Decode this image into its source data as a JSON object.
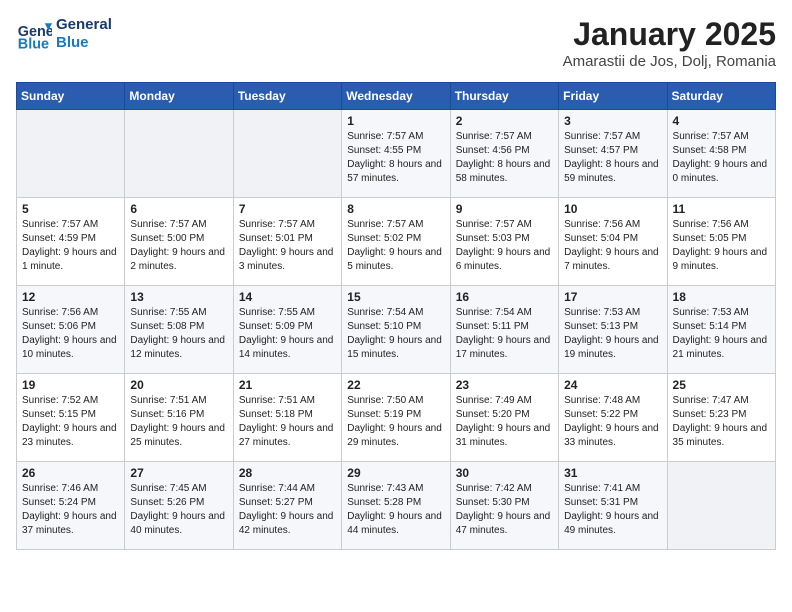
{
  "header": {
    "logo_line1": "General",
    "logo_line2": "Blue",
    "title": "January 2025",
    "subtitle": "Amarastii de Jos, Dolj, Romania"
  },
  "weekdays": [
    "Sunday",
    "Monday",
    "Tuesday",
    "Wednesday",
    "Thursday",
    "Friday",
    "Saturday"
  ],
  "weeks": [
    [
      {
        "day": "",
        "sunrise": "",
        "sunset": "",
        "daylight": ""
      },
      {
        "day": "",
        "sunrise": "",
        "sunset": "",
        "daylight": ""
      },
      {
        "day": "",
        "sunrise": "",
        "sunset": "",
        "daylight": ""
      },
      {
        "day": "1",
        "sunrise": "Sunrise: 7:57 AM",
        "sunset": "Sunset: 4:55 PM",
        "daylight": "Daylight: 8 hours and 57 minutes."
      },
      {
        "day": "2",
        "sunrise": "Sunrise: 7:57 AM",
        "sunset": "Sunset: 4:56 PM",
        "daylight": "Daylight: 8 hours and 58 minutes."
      },
      {
        "day": "3",
        "sunrise": "Sunrise: 7:57 AM",
        "sunset": "Sunset: 4:57 PM",
        "daylight": "Daylight: 8 hours and 59 minutes."
      },
      {
        "day": "4",
        "sunrise": "Sunrise: 7:57 AM",
        "sunset": "Sunset: 4:58 PM",
        "daylight": "Daylight: 9 hours and 0 minutes."
      }
    ],
    [
      {
        "day": "5",
        "sunrise": "Sunrise: 7:57 AM",
        "sunset": "Sunset: 4:59 PM",
        "daylight": "Daylight: 9 hours and 1 minute."
      },
      {
        "day": "6",
        "sunrise": "Sunrise: 7:57 AM",
        "sunset": "Sunset: 5:00 PM",
        "daylight": "Daylight: 9 hours and 2 minutes."
      },
      {
        "day": "7",
        "sunrise": "Sunrise: 7:57 AM",
        "sunset": "Sunset: 5:01 PM",
        "daylight": "Daylight: 9 hours and 3 minutes."
      },
      {
        "day": "8",
        "sunrise": "Sunrise: 7:57 AM",
        "sunset": "Sunset: 5:02 PM",
        "daylight": "Daylight: 9 hours and 5 minutes."
      },
      {
        "day": "9",
        "sunrise": "Sunrise: 7:57 AM",
        "sunset": "Sunset: 5:03 PM",
        "daylight": "Daylight: 9 hours and 6 minutes."
      },
      {
        "day": "10",
        "sunrise": "Sunrise: 7:56 AM",
        "sunset": "Sunset: 5:04 PM",
        "daylight": "Daylight: 9 hours and 7 minutes."
      },
      {
        "day": "11",
        "sunrise": "Sunrise: 7:56 AM",
        "sunset": "Sunset: 5:05 PM",
        "daylight": "Daylight: 9 hours and 9 minutes."
      }
    ],
    [
      {
        "day": "12",
        "sunrise": "Sunrise: 7:56 AM",
        "sunset": "Sunset: 5:06 PM",
        "daylight": "Daylight: 9 hours and 10 minutes."
      },
      {
        "day": "13",
        "sunrise": "Sunrise: 7:55 AM",
        "sunset": "Sunset: 5:08 PM",
        "daylight": "Daylight: 9 hours and 12 minutes."
      },
      {
        "day": "14",
        "sunrise": "Sunrise: 7:55 AM",
        "sunset": "Sunset: 5:09 PM",
        "daylight": "Daylight: 9 hours and 14 minutes."
      },
      {
        "day": "15",
        "sunrise": "Sunrise: 7:54 AM",
        "sunset": "Sunset: 5:10 PM",
        "daylight": "Daylight: 9 hours and 15 minutes."
      },
      {
        "day": "16",
        "sunrise": "Sunrise: 7:54 AM",
        "sunset": "Sunset: 5:11 PM",
        "daylight": "Daylight: 9 hours and 17 minutes."
      },
      {
        "day": "17",
        "sunrise": "Sunrise: 7:53 AM",
        "sunset": "Sunset: 5:13 PM",
        "daylight": "Daylight: 9 hours and 19 minutes."
      },
      {
        "day": "18",
        "sunrise": "Sunrise: 7:53 AM",
        "sunset": "Sunset: 5:14 PM",
        "daylight": "Daylight: 9 hours and 21 minutes."
      }
    ],
    [
      {
        "day": "19",
        "sunrise": "Sunrise: 7:52 AM",
        "sunset": "Sunset: 5:15 PM",
        "daylight": "Daylight: 9 hours and 23 minutes."
      },
      {
        "day": "20",
        "sunrise": "Sunrise: 7:51 AM",
        "sunset": "Sunset: 5:16 PM",
        "daylight": "Daylight: 9 hours and 25 minutes."
      },
      {
        "day": "21",
        "sunrise": "Sunrise: 7:51 AM",
        "sunset": "Sunset: 5:18 PM",
        "daylight": "Daylight: 9 hours and 27 minutes."
      },
      {
        "day": "22",
        "sunrise": "Sunrise: 7:50 AM",
        "sunset": "Sunset: 5:19 PM",
        "daylight": "Daylight: 9 hours and 29 minutes."
      },
      {
        "day": "23",
        "sunrise": "Sunrise: 7:49 AM",
        "sunset": "Sunset: 5:20 PM",
        "daylight": "Daylight: 9 hours and 31 minutes."
      },
      {
        "day": "24",
        "sunrise": "Sunrise: 7:48 AM",
        "sunset": "Sunset: 5:22 PM",
        "daylight": "Daylight: 9 hours and 33 minutes."
      },
      {
        "day": "25",
        "sunrise": "Sunrise: 7:47 AM",
        "sunset": "Sunset: 5:23 PM",
        "daylight": "Daylight: 9 hours and 35 minutes."
      }
    ],
    [
      {
        "day": "26",
        "sunrise": "Sunrise: 7:46 AM",
        "sunset": "Sunset: 5:24 PM",
        "daylight": "Daylight: 9 hours and 37 minutes."
      },
      {
        "day": "27",
        "sunrise": "Sunrise: 7:45 AM",
        "sunset": "Sunset: 5:26 PM",
        "daylight": "Daylight: 9 hours and 40 minutes."
      },
      {
        "day": "28",
        "sunrise": "Sunrise: 7:44 AM",
        "sunset": "Sunset: 5:27 PM",
        "daylight": "Daylight: 9 hours and 42 minutes."
      },
      {
        "day": "29",
        "sunrise": "Sunrise: 7:43 AM",
        "sunset": "Sunset: 5:28 PM",
        "daylight": "Daylight: 9 hours and 44 minutes."
      },
      {
        "day": "30",
        "sunrise": "Sunrise: 7:42 AM",
        "sunset": "Sunset: 5:30 PM",
        "daylight": "Daylight: 9 hours and 47 minutes."
      },
      {
        "day": "31",
        "sunrise": "Sunrise: 7:41 AM",
        "sunset": "Sunset: 5:31 PM",
        "daylight": "Daylight: 9 hours and 49 minutes."
      },
      {
        "day": "",
        "sunrise": "",
        "sunset": "",
        "daylight": ""
      }
    ]
  ]
}
